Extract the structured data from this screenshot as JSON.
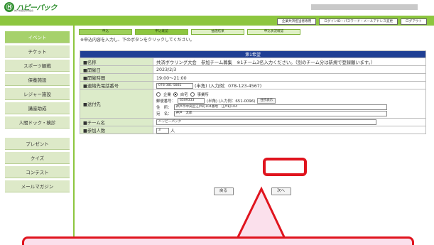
{
  "header": {
    "logo_mark": "Ⓗ",
    "logo_text": "ハピーパック",
    "logo_sub": "神戸市職員共済組合"
  },
  "top_buttons": [
    "企業共済担当者専用",
    "ログインID・パスワード・メールアドレス変更",
    "ログアウト"
  ],
  "sidebar": {
    "items": [
      "イベント",
      "チケット",
      "スポーツ観戦",
      "保養施設",
      "レジャー施設",
      "講座助成",
      "人間ドック・検診",
      "プレゼント",
      "クイズ",
      "コンテスト",
      "メールマガジン"
    ]
  },
  "tabs": [
    "申込",
    "申込確認",
    "抽選結果",
    "申込状況確認"
  ],
  "instruction": "※申込内容を入力し、下のボタンをクリックしてください。",
  "form": {
    "caption": "第1希望",
    "rows": {
      "name_label": "■名称",
      "name_value": "共済ボウリング大会　参加チーム募集　※1チーム3名入力ください。（別のチーム分は新規で登録願います。）",
      "date_label": "■開催日",
      "date_value": "2023/2/3",
      "time_label": "■開催時間",
      "time_value": "19:00～21:00",
      "phone_label": "■連絡先電話番号",
      "phone_value": "078-381-5881",
      "phone_hint": "(半角) (入力例：078-123-4567)",
      "dest_label": "■送付先",
      "radio_options": [
        "企業",
        "自宅",
        "事業所"
      ],
      "postal_label": "郵便番号：",
      "postal_value": "6509333",
      "postal_hint": "(半角) (入力例：651-0096)",
      "postal_button": "住所表示",
      "address_label": "住　所：",
      "address_value": "神戸市中央区江戸町104番地　江戸町104",
      "recipient_label": "宛　名：",
      "recipient_value": "神戸　太郎",
      "team_label": "■チーム名",
      "team_value": "ハッピーパック",
      "count_label": "■参加人数",
      "count_value": "3",
      "count_unit": "人"
    }
  },
  "buttons": {
    "back": "戻る",
    "next": "次へ"
  },
  "colors": {
    "brand_green": "#8dc63f",
    "table_header_blue": "#1f3f94",
    "highlight_red": "#e0141e",
    "callout_pink": "#fbe0ec"
  }
}
